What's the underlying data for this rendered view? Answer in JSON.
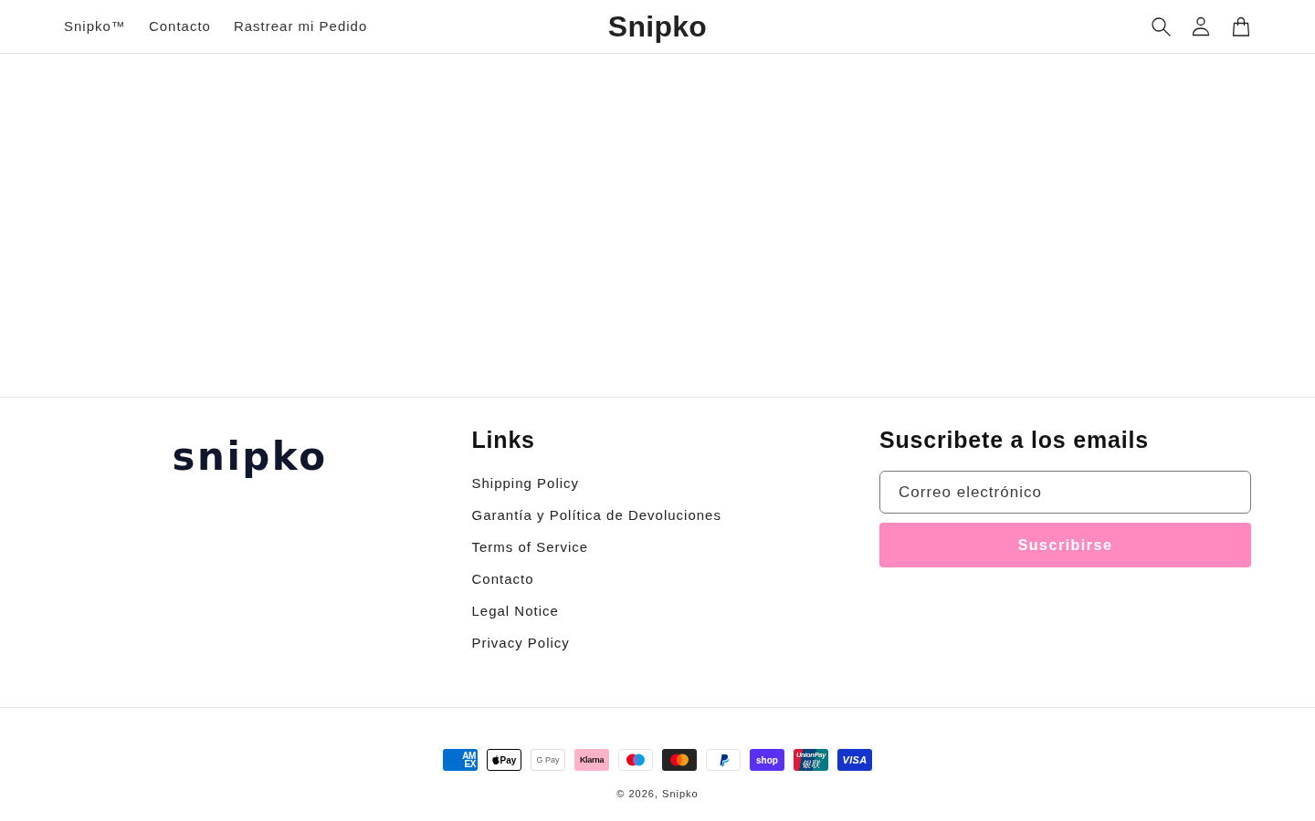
{
  "header": {
    "nav_links": [
      "Snipko™",
      "Contacto",
      "Rastrear mi Pedido"
    ],
    "logo": "Snipko"
  },
  "footer": {
    "logo": "snipko",
    "links_section": {
      "heading": "Links",
      "links": [
        "Shipping Policy",
        "Garantía y Política de Devoluciones",
        "Terms of Service",
        "Contacto",
        "Legal Notice",
        "Privacy Policy"
      ]
    },
    "newsletter": {
      "heading": "Suscribete a los emails",
      "placeholder": "Correo electrónico",
      "button": "Suscribirse"
    }
  },
  "payment_methods": [
    {
      "kind": "amex",
      "label": "AMEX"
    },
    {
      "kind": "apple_pay",
      "label": "Pay"
    },
    {
      "kind": "google_pay",
      "label": "G Pay"
    },
    {
      "kind": "klarna",
      "label": "Klarna"
    },
    {
      "kind": "maestro"
    },
    {
      "kind": "mastercard"
    },
    {
      "kind": "paypal"
    },
    {
      "kind": "shop_pay",
      "label": "shop"
    },
    {
      "kind": "unionpay",
      "label": "UnionPay",
      "sublabel": "银联"
    },
    {
      "kind": "visa",
      "label": "VISA"
    }
  ],
  "copyright": "© 2026, Snipko"
}
